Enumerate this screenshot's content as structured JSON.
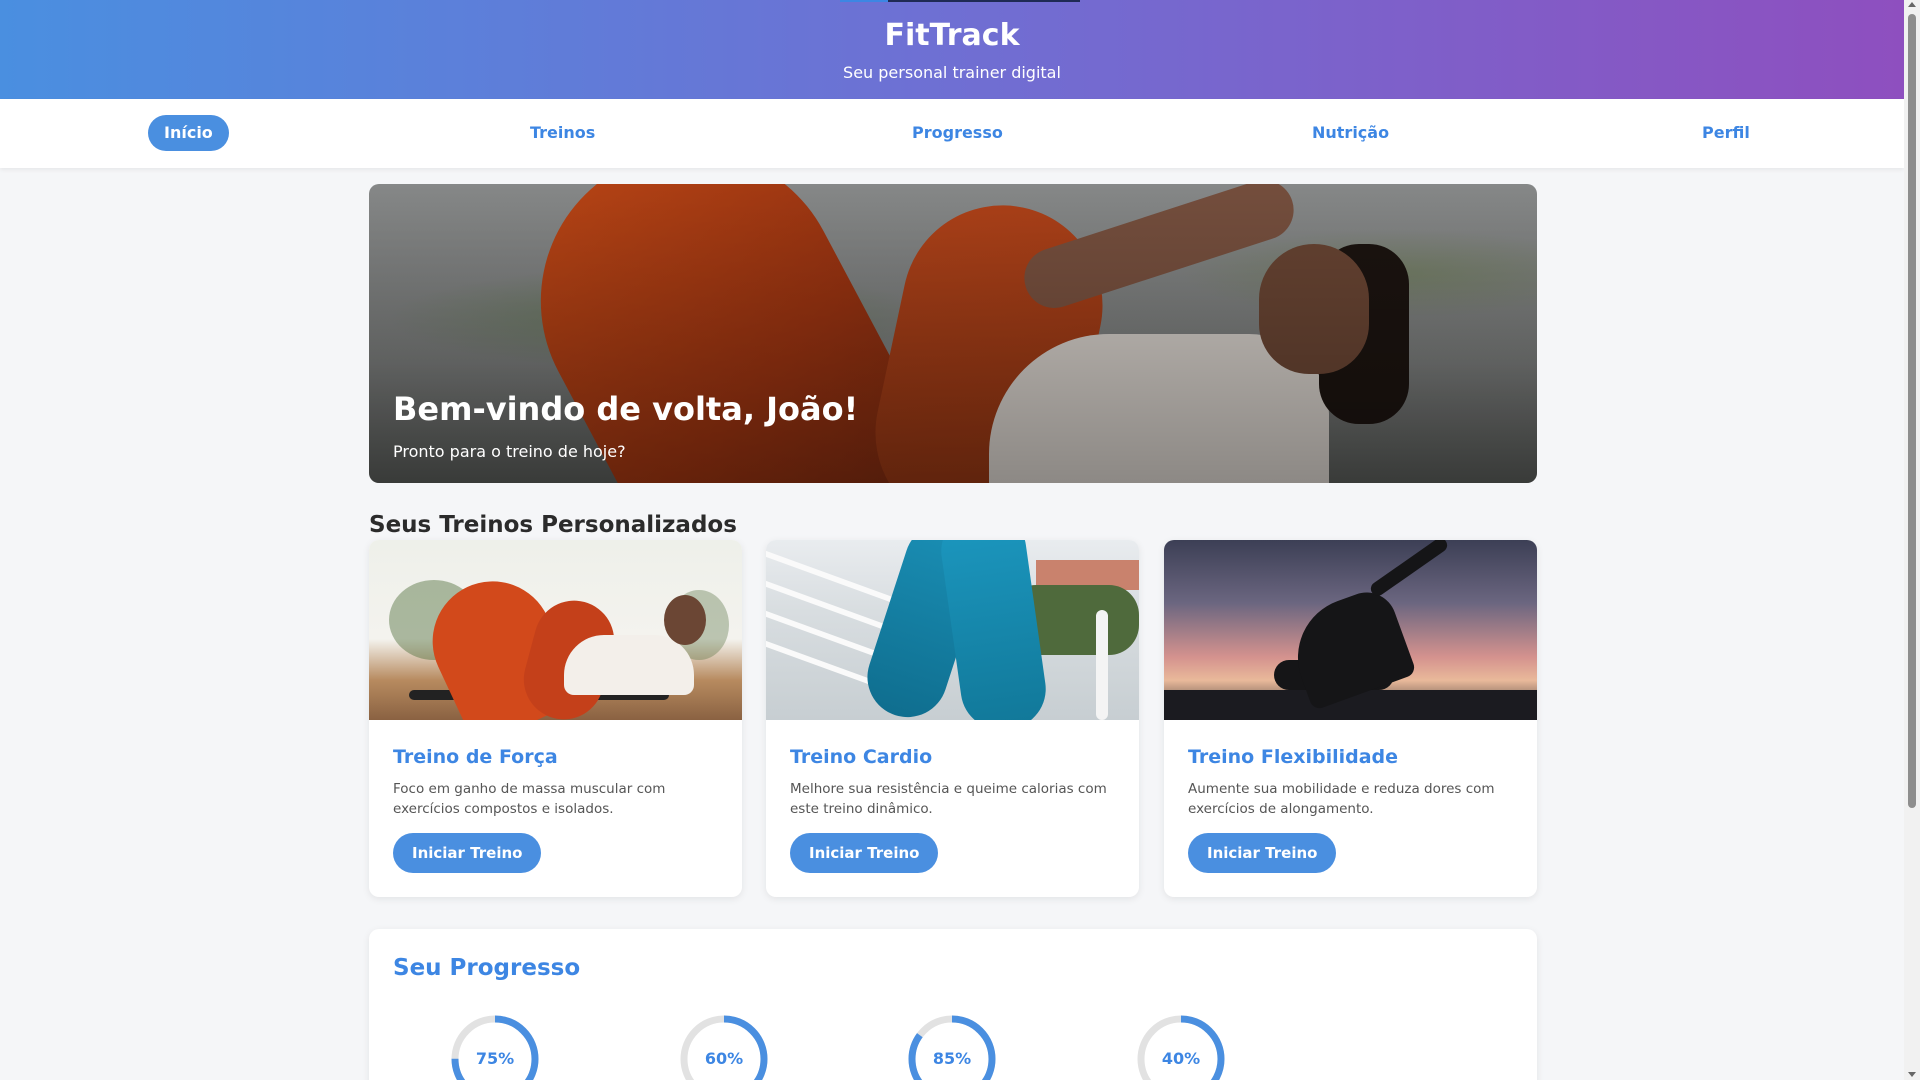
{
  "header": {
    "title": "FitTrack",
    "subtitle": "Seu personal trainer digital"
  },
  "nav": {
    "items": [
      {
        "label": "Início",
        "active": true
      },
      {
        "label": "Treinos",
        "active": false
      },
      {
        "label": "Progresso",
        "active": false
      },
      {
        "label": "Nutrição",
        "active": false
      },
      {
        "label": "Perfil",
        "active": false
      }
    ]
  },
  "hero": {
    "title": "Bem-vindo de volta, João!",
    "subtitle": "Pronto para o treino de hoje?"
  },
  "workouts": {
    "section_title": "Seus Treinos Personalizados",
    "cards": [
      {
        "title": "Treino de Força",
        "description": "Foco em ganho de massa muscular com exercícios compostos e isolados.",
        "button": "Iniciar Treino"
      },
      {
        "title": "Treino Cardio",
        "description": "Melhore sua resistência e queime calorias com este treino dinâmico.",
        "button": "Iniciar Treino"
      },
      {
        "title": "Treino Flexibilidade",
        "description": "Aumente sua mobilidade e reduza dores com exercícios de alongamento.",
        "button": "Iniciar Treino"
      }
    ]
  },
  "progress": {
    "title": "Seu Progresso",
    "items": [
      {
        "label": "75%",
        "value": 75
      },
      {
        "label": "60%",
        "value": 60
      },
      {
        "label": "85%",
        "value": 85
      },
      {
        "label": "40%",
        "value": 40
      }
    ]
  },
  "colors": {
    "accent": "#4a8fe0",
    "accent_text": "#3d86e3",
    "header_gradient_start": "#4a8fe0",
    "header_gradient_end": "#8e4fbf",
    "ring_track": "#e2e2e2"
  }
}
